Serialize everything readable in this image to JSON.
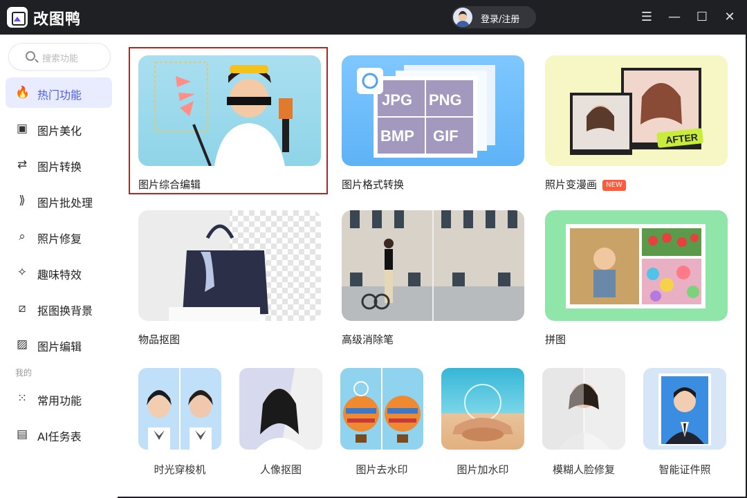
{
  "app": {
    "name": "改图鸭"
  },
  "header": {
    "login_label": "登录/注册"
  },
  "window_controls": {
    "menu": "☰",
    "minimize": "—",
    "maximize": "☐",
    "close": "✕"
  },
  "search": {
    "placeholder": "搜索功能"
  },
  "sidebar": {
    "items": [
      {
        "label": "热门功能",
        "icon": "flame-icon",
        "glyph": "🔥"
      },
      {
        "label": "图片美化",
        "icon": "image-sparkle-icon",
        "glyph": "▣"
      },
      {
        "label": "图片转换",
        "icon": "convert-icon",
        "glyph": "⇄"
      },
      {
        "label": "图片批处理",
        "icon": "batch-icon",
        "glyph": "⟫"
      },
      {
        "label": "照片修复",
        "icon": "photo-repair-icon",
        "glyph": "⌕"
      },
      {
        "label": "趣味特效",
        "icon": "magic-wand-icon",
        "glyph": "✧"
      },
      {
        "label": "抠图换背景",
        "icon": "cutout-icon",
        "glyph": "⧄"
      },
      {
        "label": "图片编辑",
        "icon": "image-edit-icon",
        "glyph": "▨"
      }
    ],
    "section_mine": "我的",
    "mine_items": [
      {
        "label": "常用功能",
        "icon": "grid-icon",
        "glyph": "⁙"
      },
      {
        "label": "AI任务表",
        "icon": "task-list-icon",
        "glyph": "▤"
      }
    ]
  },
  "features": [
    {
      "label": "图片综合编辑"
    },
    {
      "label": "图片格式转换",
      "formats": [
        "JPG",
        "PNG",
        "BMP",
        "GIF"
      ]
    },
    {
      "label": "照片变漫画",
      "badge": "NEW",
      "sticker": "AFTER"
    },
    {
      "label": "物品抠图"
    },
    {
      "label": "高级消除笔"
    },
    {
      "label": "拼图"
    }
  ],
  "small_features": [
    {
      "label": "时光穿梭机"
    },
    {
      "label": "人像抠图"
    },
    {
      "label": "图片去水印"
    },
    {
      "label": "图片加水印"
    },
    {
      "label": "模糊人脸修复"
    },
    {
      "label": "智能证件照"
    }
  ]
}
